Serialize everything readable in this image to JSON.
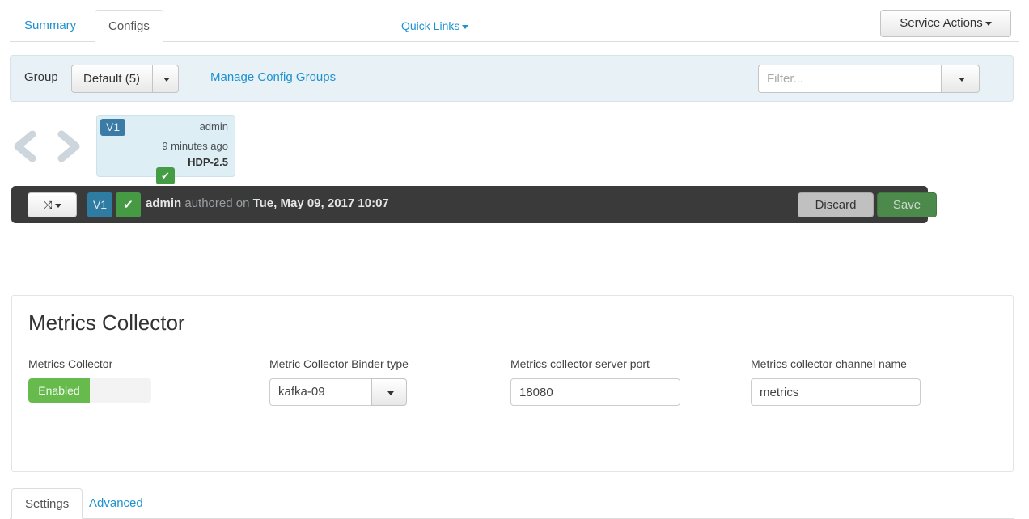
{
  "nav": {
    "tabs": [
      {
        "label": "Summary",
        "active": false
      },
      {
        "label": "Configs",
        "active": true
      }
    ],
    "quick_links": "Quick Links",
    "service_actions": "Service Actions"
  },
  "group_bar": {
    "group_label": "Group",
    "group_value": "Default (5)",
    "manage_link": "Manage Config Groups",
    "filter_placeholder": "Filter...",
    "filter_value": ""
  },
  "version_slider": {
    "prev_icon": "chevron-left-icon",
    "next_icon": "chevron-right-icon",
    "card": {
      "version": "V1",
      "author": "admin",
      "time": "9 minutes ago",
      "stack": "HDP-2.5",
      "check_icon": "✔"
    }
  },
  "toolbar": {
    "compare_icon": "⤨",
    "version": "V1",
    "check_icon": "✔",
    "author": "admin",
    "authored_text": " authored on ",
    "timestamp": "Tue, May 09, 2017 10:07",
    "discard_label": "Discard",
    "save_label": "Save"
  },
  "sub_tabs": [
    {
      "label": "Settings",
      "active": true
    },
    {
      "label": "Advanced",
      "active": false
    }
  ],
  "panel": {
    "title": "Metrics Collector",
    "fields": [
      {
        "label": "Metrics Collector",
        "type": "toggle",
        "value": "Enabled"
      },
      {
        "label": "Metric Collector Binder type",
        "type": "select",
        "value": "kafka-09"
      },
      {
        "label": "Metrics collector server port",
        "type": "text",
        "value": "18080"
      },
      {
        "label": "Metrics collector channel name",
        "type": "text",
        "value": "metrics"
      }
    ]
  },
  "colors": {
    "link": "#1e91cf",
    "panel_blue": "#e7f1f6",
    "toolbar_dark": "#3a3a3a",
    "green": "#66bb4c",
    "badge_blue": "#3a7ca5",
    "save_green": "#4b8a4b"
  }
}
